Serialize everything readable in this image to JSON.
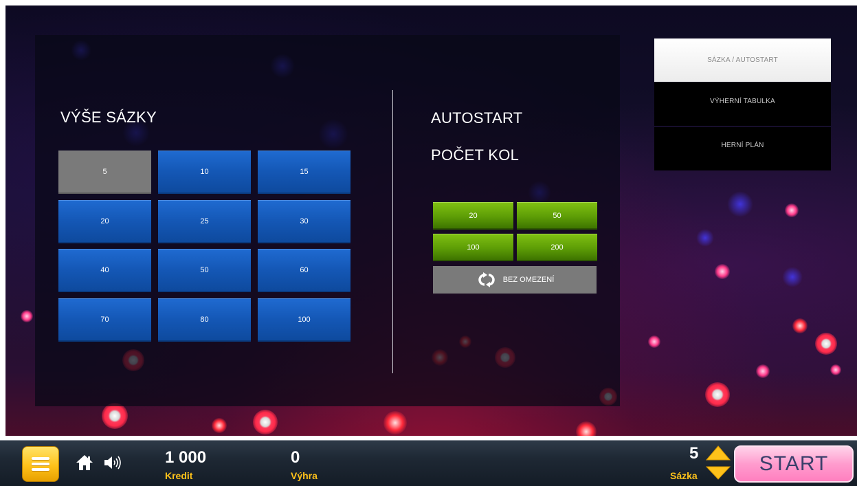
{
  "bet_panel": {
    "title": "VÝŠE SÁZKY",
    "amounts": [
      "5",
      "10",
      "15",
      "20",
      "25",
      "30",
      "40",
      "50",
      "60",
      "70",
      "80",
      "100"
    ],
    "selected": "5"
  },
  "autostart": {
    "title": "AUTOSTART",
    "subtitle": "POČET KOL",
    "rounds": [
      "20",
      "50",
      "100",
      "200"
    ],
    "unlimited_label": "BEZ OMEZENÍ"
  },
  "tabs": {
    "sazka": "SÁZKA / AUTOSTART",
    "vyherni": "VÝHERNÍ TABULKA",
    "herni": "HERNÍ PLÁN",
    "active": "SÁZKA / AUTOSTART"
  },
  "bottom_bar": {
    "credit_value": "1 000",
    "credit_label": "Kredit",
    "win_value": "0",
    "win_label": "Výhra",
    "bet_value": "5",
    "bet_label": "Sázka",
    "start_label": "START"
  },
  "icons": {
    "menu": "menu-icon",
    "home": "home-icon",
    "sound": "speaker-icon",
    "up": "arrow-up-icon",
    "down": "arrow-down-icon",
    "loop": "loop-icon"
  },
  "colors": {
    "bet_button": "#1457b5",
    "selected_button": "#7a7a7a",
    "round_button": "#5d9d06",
    "accent_yellow": "#ffc21a",
    "start_button": "#ff9cce"
  }
}
